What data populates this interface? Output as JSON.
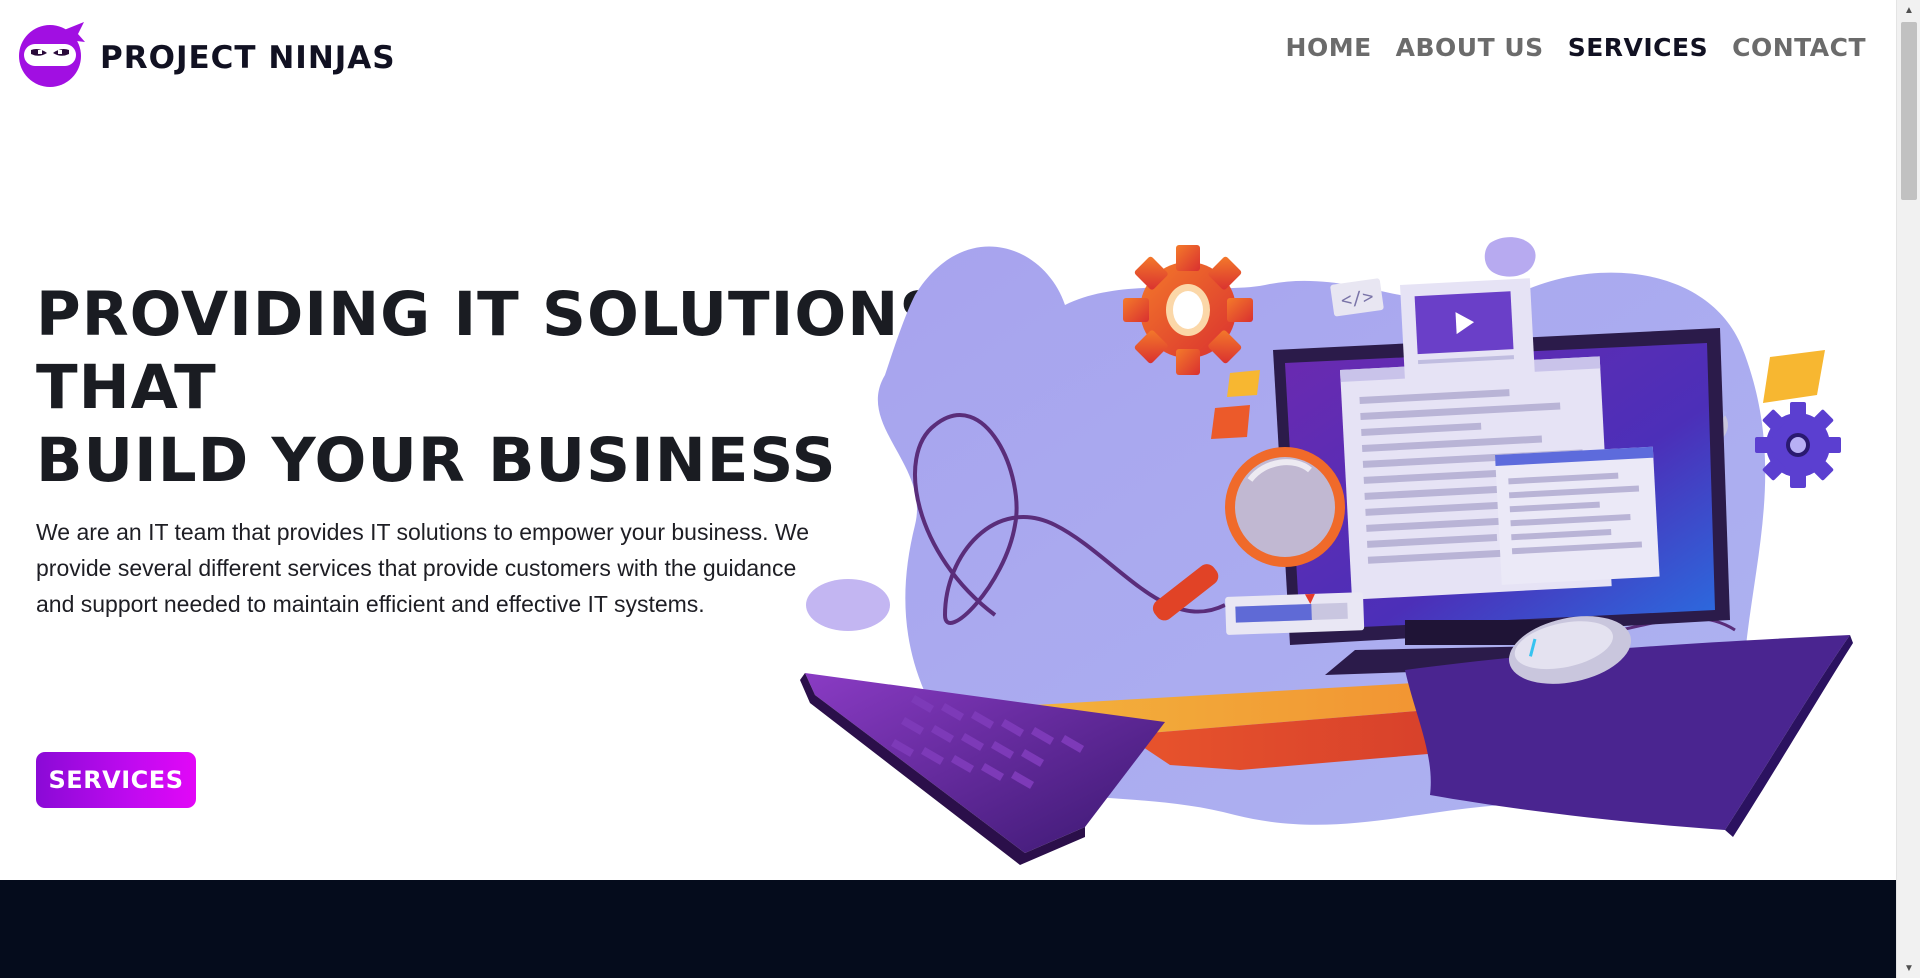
{
  "brand": {
    "name": "PROJECT NINJAS",
    "accent": "#c00af0",
    "dark": "#050c1c"
  },
  "nav": {
    "items": [
      {
        "label": "HOME",
        "active": false
      },
      {
        "label": "ABOUT US",
        "active": false
      },
      {
        "label": "SERVICES",
        "active": true
      },
      {
        "label": "CONTACT",
        "active": false
      }
    ]
  },
  "hero": {
    "title_line1": "PROVIDING IT SOLUTIONS THAT",
    "title_line2": "BUILD YOUR BUSINESS",
    "paragraph": "We are an IT team that provides IT solutions to empower your business. We provide several different services that provide customers with the guidance and support needed to maintain efficient and effective IT systems.",
    "cta_label": "SERVICES"
  },
  "icons": {
    "logo": "ninja-mascot-icon",
    "scroll_up": "scroll-up-arrow-icon",
    "scroll_down": "scroll-down-arrow-icon"
  }
}
